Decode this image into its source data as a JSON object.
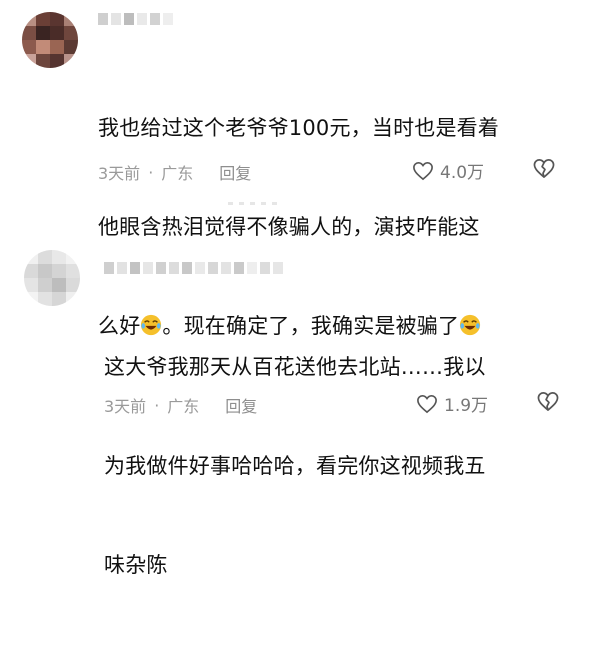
{
  "comments": [
    {
      "text_lines": [
        "我也给过这个老爷爷100元，当时也是看着",
        "他眼含热泪觉得不像骗人的，演技咋能这",
        "么好"
      ],
      "text_tail_1": "。现在确定了，我确实是被骗了",
      "time": "3天前",
      "dot": "·",
      "location": "广东",
      "reply": "回复",
      "likes": "4.0万"
    },
    {
      "text_lines": [
        "这大爷我那天从百花送他去北站……我以",
        "为我做件好事哈哈哈，看完你这视频我五",
        "味杂陈"
      ],
      "time": "3天前",
      "dot": "·",
      "location": "广东",
      "reply": "回复",
      "likes": "1.9万"
    }
  ],
  "icons": {
    "like": "heart-outline-icon",
    "dislike": "broken-heart-icon",
    "emoji": "laughing-tears-emoji"
  },
  "colors": {
    "text": "#111111",
    "meta": "#9a9a9a",
    "emoji_face": "#f5c02b"
  }
}
